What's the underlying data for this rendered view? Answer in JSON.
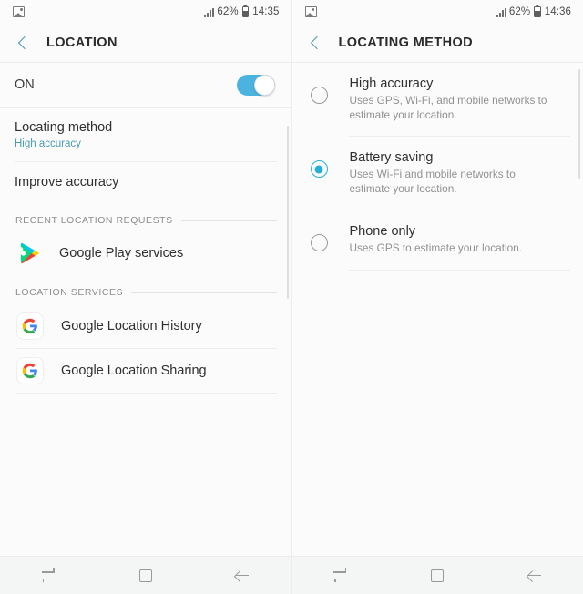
{
  "colors": {
    "accent_teal": "#4a93ad",
    "accent_blue": "#4bb3e0",
    "radio_selected": "#24b0d5",
    "background": "#fbfbfb",
    "text_primary": "#2f2f2f",
    "text_secondary": "#919191"
  },
  "left_phone": {
    "status_bar": {
      "notification_icon": "photo-icon",
      "signal_icon": "signal-bars-icon",
      "battery_percent": "62%",
      "battery_icon": "battery-icon",
      "clock": "14:35"
    },
    "app_bar": {
      "back_icon": "back-chevron-icon",
      "title": "LOCATION"
    },
    "master_toggle": {
      "label": "ON",
      "state": "on"
    },
    "items": [
      {
        "title": "Locating method",
        "subtitle": "High accuracy"
      },
      {
        "title": "Improve accuracy",
        "subtitle": ""
      }
    ],
    "sections": [
      {
        "header": "RECENT LOCATION REQUESTS",
        "rows": [
          {
            "label": "Google Play services",
            "icon": "google-play-services-icon"
          }
        ]
      },
      {
        "header": "LOCATION SERVICES",
        "rows": [
          {
            "label": "Google Location History",
            "icon": "google-g-icon"
          },
          {
            "label": "Google Location Sharing",
            "icon": "google-g-icon"
          }
        ]
      }
    ],
    "nav_bar": {
      "recents_label": "Recents",
      "home_label": "Home",
      "back_label": "Back"
    }
  },
  "right_phone": {
    "status_bar": {
      "notification_icon": "photo-icon",
      "signal_icon": "signal-bars-icon",
      "battery_percent": "62%",
      "battery_icon": "battery-icon",
      "clock": "14:36"
    },
    "app_bar": {
      "back_icon": "back-chevron-icon",
      "title": "LOCATING METHOD"
    },
    "options": [
      {
        "title": "High accuracy",
        "description": "Uses GPS, Wi-Fi, and mobile networks to estimate your location.",
        "selected": false
      },
      {
        "title": "Battery saving",
        "description": "Uses Wi-Fi and mobile networks to estimate your location.",
        "selected": true
      },
      {
        "title": "Phone only",
        "description": "Uses GPS to estimate your location.",
        "selected": false
      }
    ],
    "nav_bar": {
      "recents_label": "Recents",
      "home_label": "Home",
      "back_label": "Back"
    }
  }
}
